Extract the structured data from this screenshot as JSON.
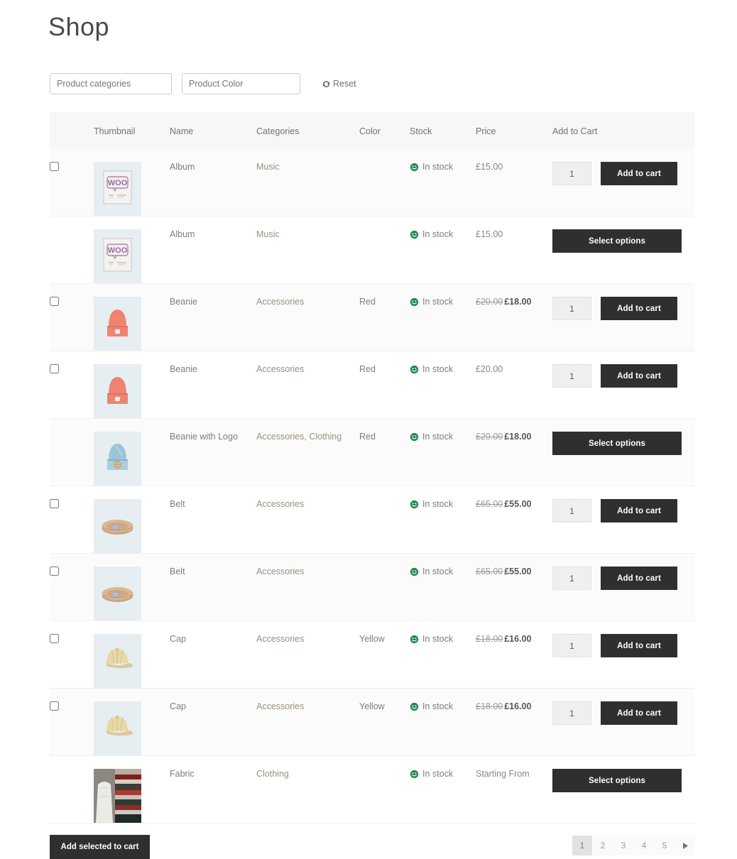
{
  "page": {
    "title": "Shop"
  },
  "filters": {
    "categories_placeholder": "Product categories",
    "color_placeholder": "Product Color",
    "reset_label": "Reset",
    "reset_icon": "refresh-icon"
  },
  "table": {
    "headers": {
      "checkbox": "",
      "thumbnail": "Thumbnail",
      "name": "Name",
      "categories": "Categories",
      "color": "Color",
      "stock": "Stock",
      "price": "Price",
      "cart": "Add to Cart",
      "extra": ""
    },
    "stock_icon": "in-stock-smiley-icon",
    "qty_value": "1",
    "add_to_cart_label": "Add to cart",
    "select_options_label": "Select options",
    "rows": [
      {
        "has_checkbox": true,
        "thumb": "album-woo",
        "name": "Album",
        "categories": "Music",
        "color": "",
        "stock": "In stock",
        "price_old": "",
        "price_new": "",
        "price_plain": "£15.00",
        "action": "add"
      },
      {
        "has_checkbox": false,
        "thumb": "album-woo",
        "name": "Album",
        "categories": "Music",
        "color": "",
        "stock": "In stock",
        "price_old": "",
        "price_new": "",
        "price_plain": "£15.00",
        "action": "select"
      },
      {
        "has_checkbox": true,
        "thumb": "beanie-red",
        "name": "Beanie",
        "categories": "Accessories",
        "color": "Red",
        "stock": "In stock",
        "price_old": "£20.00",
        "price_new": "£18.00",
        "price_plain": "",
        "action": "add"
      },
      {
        "has_checkbox": true,
        "thumb": "beanie-red",
        "name": "Beanie",
        "categories": "Accessories",
        "color": "Red",
        "stock": "In stock",
        "price_old": "",
        "price_new": "",
        "price_plain": "£20.00",
        "action": "add"
      },
      {
        "has_checkbox": false,
        "thumb": "beanie-blue-logo",
        "name": "Beanie with Logo",
        "categories": "Accessories, Clothing",
        "color": "Red",
        "stock": "In stock",
        "price_old": "£20.00",
        "price_new": "£18.00",
        "price_plain": "",
        "action": "select"
      },
      {
        "has_checkbox": true,
        "thumb": "belt",
        "name": "Belt",
        "categories": "Accessories",
        "color": "",
        "stock": "In stock",
        "price_old": "£65.00",
        "price_new": "£55.00",
        "price_plain": "",
        "action": "add"
      },
      {
        "has_checkbox": true,
        "thumb": "belt",
        "name": "Belt",
        "categories": "Accessories",
        "color": "",
        "stock": "In stock",
        "price_old": "£65.00",
        "price_new": "£55.00",
        "price_plain": "",
        "action": "add"
      },
      {
        "has_checkbox": true,
        "thumb": "cap",
        "name": "Cap",
        "categories": "Accessories",
        "color": "Yellow",
        "stock": "In stock",
        "price_old": "£18.00",
        "price_new": "£16.00",
        "price_plain": "",
        "action": "add"
      },
      {
        "has_checkbox": true,
        "thumb": "cap",
        "name": "Cap",
        "categories": "Accessories",
        "color": "Yellow",
        "stock": "In stock",
        "price_old": "£18.00",
        "price_new": "£16.00",
        "price_plain": "",
        "action": "add"
      },
      {
        "has_checkbox": false,
        "thumb": "fabric",
        "name": "Fabric",
        "categories": "Clothing",
        "color": "",
        "stock": "In stock",
        "price_old": "",
        "price_new": "",
        "price_plain": "Starting From",
        "action": "select"
      }
    ]
  },
  "footer": {
    "add_selected_label": "Add selected to cart",
    "pagination": {
      "pages": [
        "1",
        "2",
        "3",
        "4",
        "5"
      ],
      "active": "1",
      "next_icon": "chevron-right-icon"
    }
  },
  "colors": {
    "button_dark": "#2f2f2f",
    "stock_green": "#1f8a4c",
    "thumb_bg": "#e6eef2",
    "header_bg": "#f7f7f7",
    "row_odd": "#fbfbfb",
    "link_brown": "#9b9080"
  }
}
